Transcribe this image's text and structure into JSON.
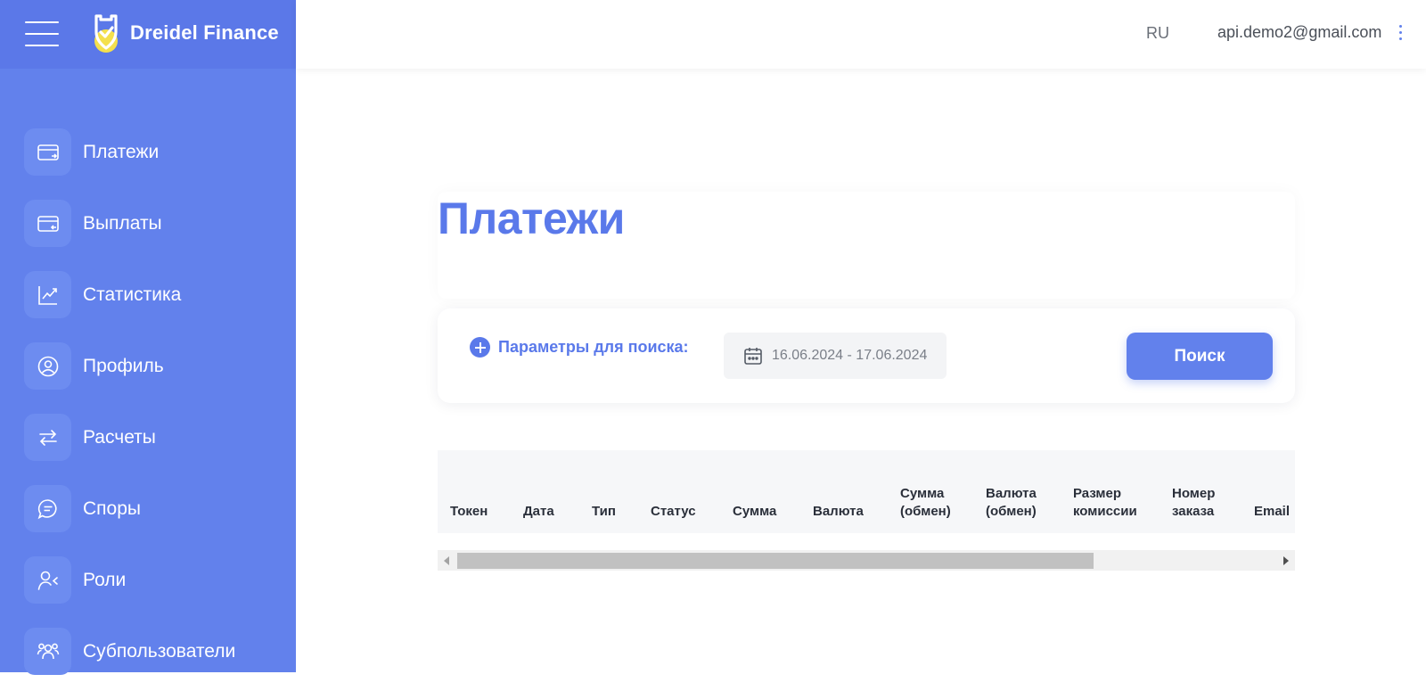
{
  "app": {
    "brand": "Dreidel Finance",
    "logo_icon": "shield-check-icon",
    "accent": "#6281ec"
  },
  "header": {
    "language": "RU",
    "user_email": "api.demo2@gmail.com",
    "menu_icon": "kebab-menu-icon"
  },
  "sidebar": {
    "items": [
      {
        "label": "Платежи",
        "icon": "card-in-icon"
      },
      {
        "label": "Выплаты",
        "icon": "card-out-icon"
      },
      {
        "label": "Статистика",
        "icon": "chart-line-icon"
      },
      {
        "label": "Профиль",
        "icon": "user-circle-icon"
      },
      {
        "label": "Расчеты",
        "icon": "arrows-exchange-icon"
      },
      {
        "label": "Споры",
        "icon": "chat-bubble-icon"
      },
      {
        "label": "Роли",
        "icon": "user-roles-icon"
      },
      {
        "label": "Субпользователи",
        "icon": "users-group-icon"
      }
    ]
  },
  "main": {
    "title": "Платежи",
    "filter": {
      "add_params_label": "Параметры для поиска:",
      "date_range": "16.06.2024 - 17.06.2024",
      "search_label": "Поиск"
    },
    "table": {
      "columns": [
        {
          "line1": "",
          "line2": "Токен"
        },
        {
          "line1": "",
          "line2": "Дата"
        },
        {
          "line1": "",
          "line2": "Тип"
        },
        {
          "line1": "",
          "line2": "Статус"
        },
        {
          "line1": "",
          "line2": "Сумма"
        },
        {
          "line1": "",
          "line2": "Валюта"
        },
        {
          "line1": "Сумма",
          "line2": "(обмен)"
        },
        {
          "line1": "Валюта",
          "line2": "(обмен)"
        },
        {
          "line1": "Размер",
          "line2": "комиссии"
        },
        {
          "line1": "Номер",
          "line2": "заказа"
        },
        {
          "line1": "",
          "line2": "Email"
        }
      ]
    }
  }
}
